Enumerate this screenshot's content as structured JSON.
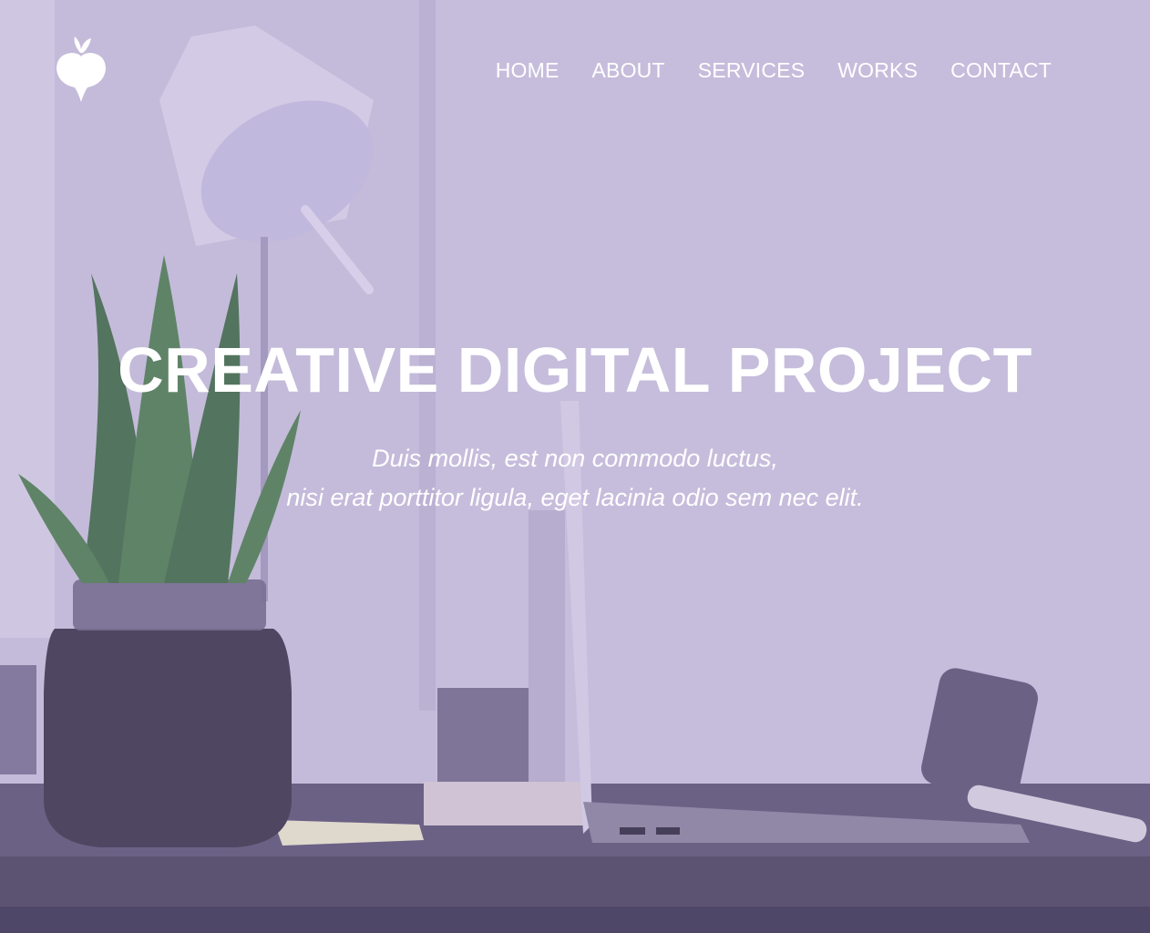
{
  "nav": {
    "items": [
      {
        "label": "HOME"
      },
      {
        "label": "ABOUT"
      },
      {
        "label": "SERVICES"
      },
      {
        "label": "WORKS"
      },
      {
        "label": "CONTACT"
      }
    ]
  },
  "hero": {
    "title": "CREATIVE DIGITAL PROJECT",
    "subtitle_line1": "Duis mollis, est non commodo luctus,",
    "subtitle_line2": "nisi erat porttitor ligula, eget lacinia odio sem nec elit."
  },
  "logo": {
    "icon": "radish-icon"
  },
  "colors": {
    "overlay_tint": "#c6bfda",
    "text": "#ffffff",
    "desk": "#4b445f"
  }
}
